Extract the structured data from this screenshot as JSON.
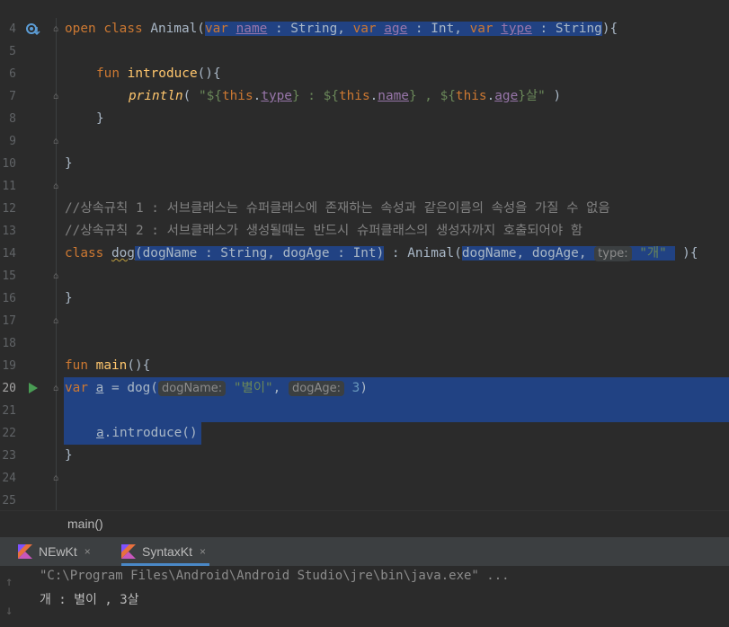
{
  "editor": {
    "line_numbers": [
      "4",
      "5",
      "6",
      "7",
      "8",
      "9",
      "10",
      "11",
      "12",
      "13",
      "14",
      "15",
      "16",
      "17",
      "18",
      "19",
      "20",
      "21",
      "22",
      "23",
      "24",
      "25"
    ],
    "current_line": "20",
    "lines": {
      "l4": {
        "kw_open": "open ",
        "kw_class": "class ",
        "name": "Animal(",
        "p1kw": "var ",
        "p1": "name",
        "p1t": " : String, ",
        "p2kw": "var ",
        "p2": "age",
        "p2t": " : Int, ",
        "p3kw": "var ",
        "p3": "type",
        "p3t": " : String",
        "end": "){"
      },
      "l6": {
        "kw": "fun ",
        "fn": "introduce",
        "rest": "(){"
      },
      "l7": {
        "fn": "println",
        "a": "( ",
        "s1": "\"${",
        "t1": "this",
        "d1": ".",
        "v1": "type",
        "s2": "} : ${",
        "t2": "this",
        "d2": ".",
        "v2": "name",
        "s3": "} , ${",
        "t3": "this",
        "d3": ".",
        "v3": "age",
        "s4": "}살\"",
        "b": " )"
      },
      "l8": {
        "text": "}"
      },
      "l10": {
        "text": "}"
      },
      "l12": {
        "text": "//상속규칙 1 : 서브클래스는 슈퍼클래스에 존재하는 속성과 같은이름의 속성을 가질 수 없음"
      },
      "l13": {
        "text": "//상속규칙 2 : 서브클래스가 생성될때는 반드시 슈퍼클래스의 생성자까지 호출되어야 함"
      },
      "l14": {
        "kw": "class ",
        "name": "dog",
        "params": "(dogName : String, dogAge : Int)",
        "mid": " : Animal(",
        "args": "dogName, dogAge, ",
        "hint": "type:",
        "str": "\"개\"",
        "end": " ){"
      },
      "l16": {
        "text": "}"
      },
      "l19": {
        "kw": "fun ",
        "fn": "main",
        "rest": "(){"
      },
      "l20": {
        "kw": "var ",
        "v": "a",
        "eq": " = dog(",
        "h1": "dogName:",
        "s1": "\"별이\"",
        "comma": ", ",
        "h2": "dogAge:",
        "num": "3",
        "end": ")"
      },
      "l22": {
        "v": "a",
        "rest": ".introduce()"
      },
      "l23": {
        "text": "}"
      }
    }
  },
  "breadcrumb": {
    "label": "main()"
  },
  "run_tabs": [
    {
      "label": "NEwKt",
      "close": "×"
    },
    {
      "label": "SyntaxKt",
      "close": "×"
    }
  ],
  "console": {
    "command": "\"C:\\Program Files\\Android\\Android Studio\\jre\\bin\\java.exe\" ...",
    "output": "개 : 별이 , 3살"
  },
  "colors": {
    "selection": "#214283",
    "keyword": "#cc7832",
    "function": "#ffc66d",
    "string": "#6a8759",
    "property": "#9876aa"
  }
}
